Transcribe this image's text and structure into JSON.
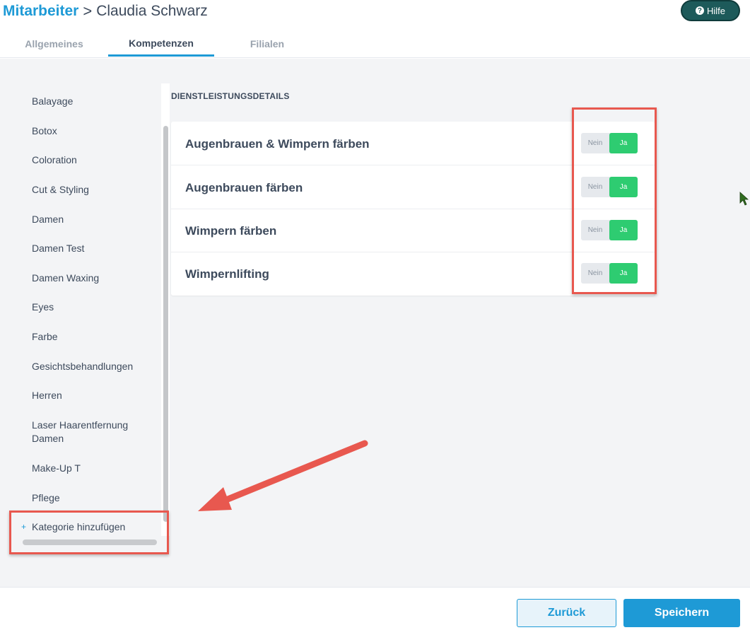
{
  "breadcrumb": {
    "root": "Mitarbeiter",
    "separator": ">",
    "current": "Claudia Schwarz"
  },
  "help": {
    "label": "Hilfe",
    "icon": "question-icon"
  },
  "tabs": [
    {
      "label": "Allgemeines",
      "active": false
    },
    {
      "label": "Kompetenzen",
      "active": true
    },
    {
      "label": "Filialen",
      "active": false
    }
  ],
  "sidebar": {
    "categories": [
      "Balayage",
      "Botox",
      "Coloration",
      "Cut & Styling",
      "Damen",
      "Damen Test",
      "Damen Waxing",
      "Eyes",
      "Farbe",
      "Gesichtsbehandlungen",
      "Herren",
      "Laser Haarentfernung Damen",
      "Make-Up T",
      "Pflege"
    ],
    "add_label": "Kategorie hinzufügen",
    "add_icon": "+"
  },
  "section_title": "DIENSTLEISTUNGSDETAILS",
  "services": [
    {
      "name": "Augenbrauen & Wimpern färben",
      "no": "Nein",
      "yes": "Ja",
      "selected": "Ja"
    },
    {
      "name": "Augenbrauen färben",
      "no": "Nein",
      "yes": "Ja",
      "selected": "Ja"
    },
    {
      "name": "Wimpern färben",
      "no": "Nein",
      "yes": "Ja",
      "selected": "Ja"
    },
    {
      "name": "Wimpernlifting",
      "no": "Nein",
      "yes": "Ja",
      "selected": "Ja"
    }
  ],
  "footer": {
    "back_label": "Zurück",
    "save_label": "Speichern"
  },
  "colors": {
    "accent": "#1e9ad6",
    "toggle_on": "#2ecc71",
    "help_bg": "#1d5a5a",
    "annotation": "#e8584f"
  }
}
